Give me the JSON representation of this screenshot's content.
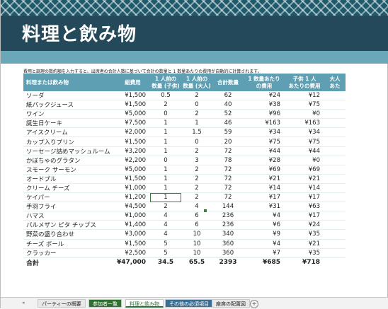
{
  "title": "料理と飲み物",
  "note": "費用と調理の数約額を入力すると、出席者の合計人数に基づいて合計の数量と 1 数量あたりの費用が自動的に計算されます。",
  "headers": [
    "料理または飲み物",
    "総費用",
    "1 人前の\n数量 (子供)",
    "1 人前の\n数量 (大人)",
    "合計数量",
    "1 数量あたり\nの費用",
    "子供 1 人\nあたりの費用",
    "大人\nあた"
  ],
  "rows": [
    [
      "ソーダ",
      "¥1,500",
      "0.5",
      "2",
      "62",
      "¥24",
      "¥12"
    ],
    [
      "紙パックジュース",
      "¥1,500",
      "2",
      "0",
      "40",
      "¥38",
      "¥75"
    ],
    [
      "ワイン",
      "¥5,000",
      "0",
      "2",
      "52",
      "¥96",
      "¥0"
    ],
    [
      "誕生日ケーキ",
      "¥7,500",
      "1",
      "1",
      "46",
      "¥163",
      "¥163"
    ],
    [
      "アイスクリーム",
      "¥2,000",
      "1",
      "1.5",
      "59",
      "¥34",
      "¥34"
    ],
    [
      "カップ入りプリン",
      "¥1,500",
      "1",
      "0",
      "20",
      "¥75",
      "¥75"
    ],
    [
      "ソーセージ詰めマッシュルーム",
      "¥3,200",
      "1",
      "2",
      "72",
      "¥44",
      "¥44"
    ],
    [
      "かぼちゃのグラタン",
      "¥2,200",
      "0",
      "3",
      "78",
      "¥28",
      "¥0"
    ],
    [
      "スモーク サーモン",
      "¥5,000",
      "1",
      "2",
      "72",
      "¥69",
      "¥69"
    ],
    [
      "オードブル",
      "¥1,500",
      "1",
      "2",
      "72",
      "¥21",
      "¥21"
    ],
    [
      "クリーム チーズ",
      "¥1,000",
      "1",
      "2",
      "72",
      "¥14",
      "¥14"
    ],
    [
      "ケイパー",
      "¥1,200",
      "1",
      "2",
      "72",
      "¥17",
      "¥17"
    ],
    [
      "手羽フライ",
      "¥4,500",
      "2",
      "4",
      "144",
      "¥31",
      "¥63"
    ],
    [
      "ハマス",
      "¥1,000",
      "4",
      "6",
      "236",
      "¥4",
      "¥17"
    ],
    [
      "パルメザン ピタ チップス",
      "¥1,400",
      "4",
      "6",
      "236",
      "¥6",
      "¥24"
    ],
    [
      "野菜の盛り合わせ",
      "¥3,000",
      "4",
      "10",
      "340",
      "¥9",
      "¥35"
    ],
    [
      "チーズ ボール",
      "¥1,500",
      "5",
      "10",
      "360",
      "¥4",
      "¥21"
    ],
    [
      "クラッカー",
      "¥2,500",
      "5",
      "10",
      "360",
      "¥7",
      "¥35"
    ]
  ],
  "total": [
    "合計",
    "¥47,000",
    "34.5",
    "65.5",
    "2393",
    "¥685",
    "¥718"
  ],
  "tabs": [
    "パーティーの概要",
    "参加者一覧",
    "料理と飲み物",
    "その他の必須項目",
    "座席の配置図"
  ],
  "add_tab": "+",
  "colors": {
    "header": "#5f9fb3",
    "banner": "#24495a",
    "band": "#6aa7b9",
    "active_tab": "#2f6f3a"
  }
}
